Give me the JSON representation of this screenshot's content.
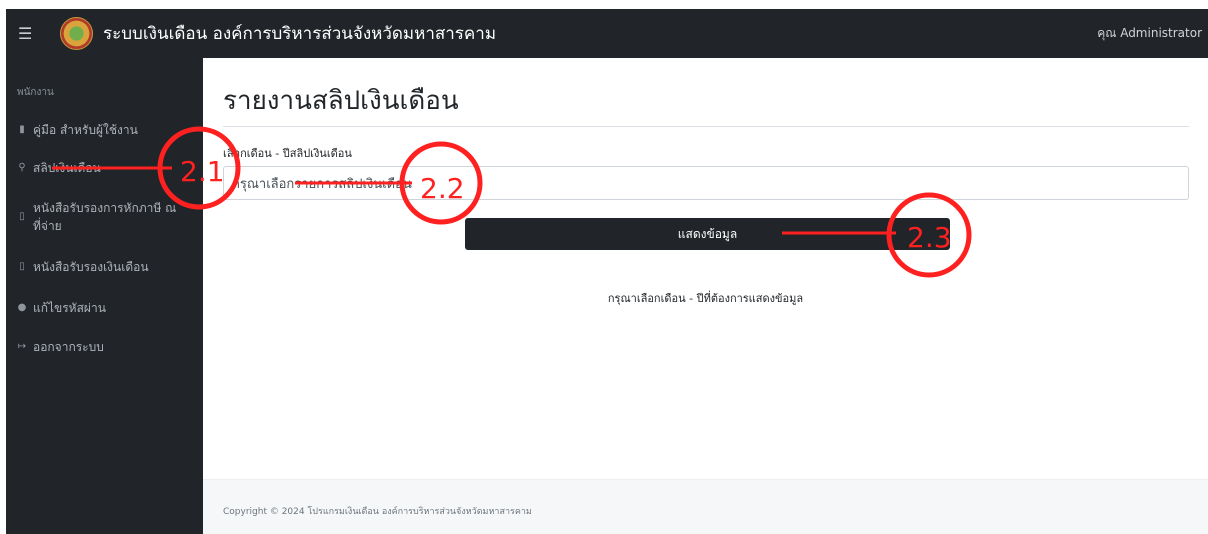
{
  "header": {
    "menu_icon": "hamburger-icon",
    "logo": "emblem-logo",
    "title": "ระบบเงินเดือน องค์การบริหารส่วนจังหวัดมหาสารคาม",
    "user": "คุณ Administrator"
  },
  "sidebar": {
    "heading": "พนักงาน",
    "items": [
      {
        "label": "คู่มือ สำหรับผู้ใช้งาน",
        "icon": "document-icon"
      },
      {
        "label": "สลิปเงินเดือน",
        "icon": "search-icon"
      },
      {
        "label": "หนังสือรับรองการหักภาษี ณ ที่จ่าย",
        "icon": "file-icon"
      },
      {
        "label": "หนังสือรับรองเงินเดือน",
        "icon": "file-icon"
      },
      {
        "label": "แก้ไขรหัสผ่าน",
        "icon": "user-key-icon"
      },
      {
        "label": "ออกจากระบบ",
        "icon": "sign-out-icon"
      }
    ]
  },
  "main": {
    "title": "รายงานสลิปเงินเดือน",
    "field_label": "เลือกเดือน - ปีสลิปเงินเดือน",
    "select_value": "กรุณาเลือกรายการสลิปเงินเดือน",
    "button_label": "แสดงข้อมูล",
    "hint": "กรุณาเลือกเดือน - ปีที่ต้องการแสดงข้อมูล"
  },
  "footer": {
    "copyright": "Copyright © 2024 โปรแกรมเงินเดือน องค์การบริหารส่วนจังหวัดมหาสารคาม"
  },
  "annotations": {
    "color": "#ff2020",
    "labels": [
      "2.1",
      "2.2",
      "2.3"
    ]
  }
}
